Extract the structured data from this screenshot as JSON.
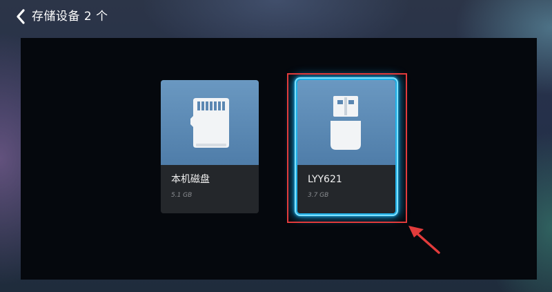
{
  "header": {
    "back_icon": "chevron-left-icon",
    "title": "存储设备 2 个"
  },
  "devices": [
    {
      "name": "本机磁盘",
      "size": "5.1 GB",
      "icon": "sd-card-icon",
      "selected": false
    },
    {
      "name": "LYY621",
      "size": "3.7 GB",
      "icon": "usb-drive-icon",
      "selected": true
    }
  ],
  "annotation": {
    "highlight_color": "#e23b3b",
    "focus_glow_color": "#22b6f0"
  }
}
